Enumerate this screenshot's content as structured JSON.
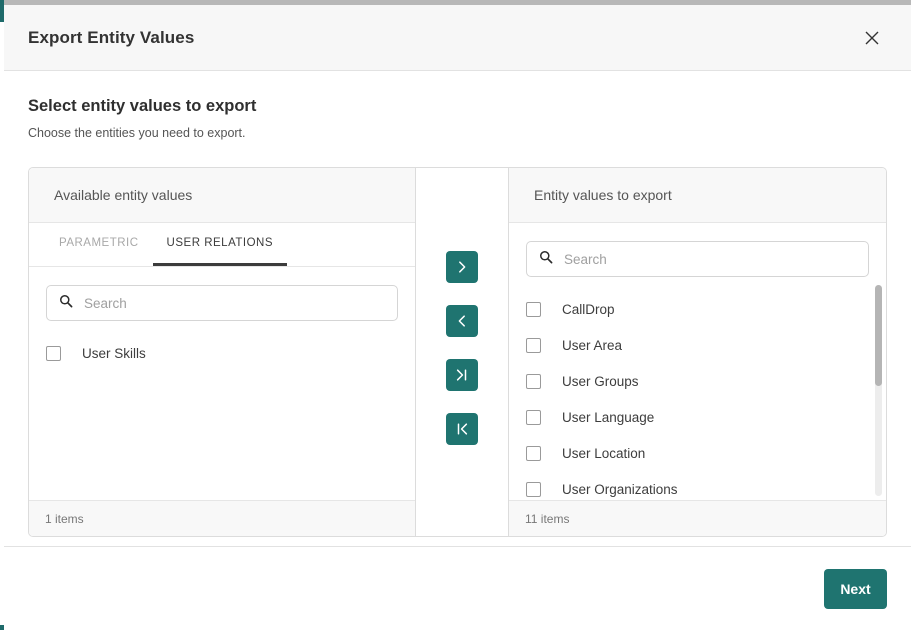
{
  "dialog": {
    "title": "Export Entity Values",
    "close_icon": "close-icon"
  },
  "section": {
    "title": "Select entity values to export",
    "subtitle": "Choose the entities you need to export."
  },
  "available_panel": {
    "header": "Available entity values",
    "tabs": [
      {
        "label": "PARAMETRIC",
        "active": false
      },
      {
        "label": "USER RELATIONS",
        "active": true
      }
    ],
    "search": {
      "placeholder": "Search",
      "value": "",
      "icon": "search-icon"
    },
    "items": [
      {
        "label": "User Skills",
        "checked": false
      }
    ],
    "footer": "1 items"
  },
  "transfer_buttons": [
    {
      "name": "move-right-button",
      "icon": "chevron-right-icon"
    },
    {
      "name": "move-left-button",
      "icon": "chevron-left-icon"
    },
    {
      "name": "move-all-right-button",
      "icon": "chevron-right-bar-icon"
    },
    {
      "name": "move-all-left-button",
      "icon": "chevron-left-bar-icon"
    }
  ],
  "export_panel": {
    "header": "Entity values to export",
    "search": {
      "placeholder": "Search",
      "value": "",
      "icon": "search-icon"
    },
    "items": [
      {
        "label": "CallDrop",
        "checked": false
      },
      {
        "label": "User Area",
        "checked": false
      },
      {
        "label": "User Groups",
        "checked": false
      },
      {
        "label": "User Language",
        "checked": false
      },
      {
        "label": "User Location",
        "checked": false
      },
      {
        "label": "User Organizations",
        "checked": false
      }
    ],
    "footer": "11 items"
  },
  "footer": {
    "next_label": "Next"
  },
  "colors": {
    "accent": "#1F7470",
    "header_bg": "#F7F7F7",
    "border": "#DCDCDC",
    "text": "#3C3C3C"
  }
}
